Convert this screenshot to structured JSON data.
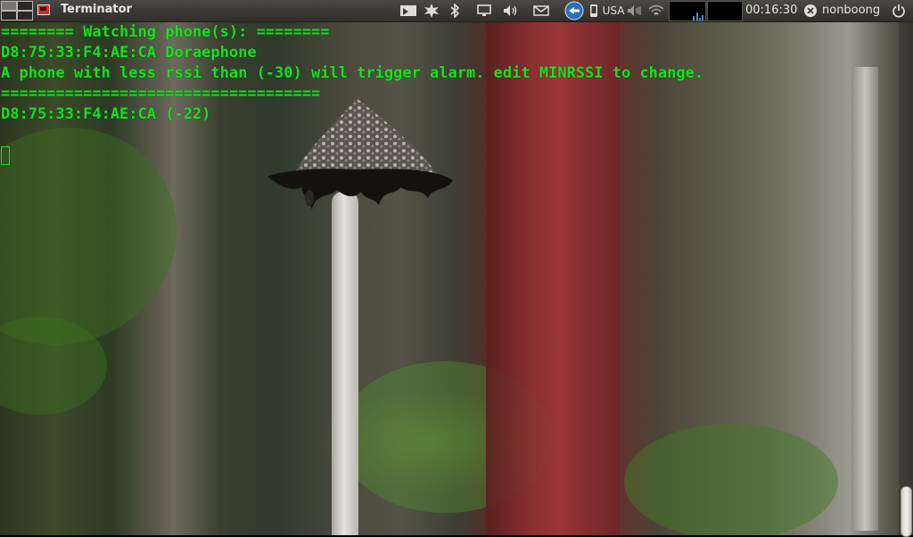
{
  "panel": {
    "app_title": "Terminator",
    "keyboard_layout": "USA",
    "clock": "00:16:30",
    "username": "nonboong",
    "icons": [
      "workspace-switcher-icon",
      "terminator-app-icon",
      "screenshot-icon",
      "network-transfer-icon",
      "bluetooth-icon",
      "display-icon",
      "volume-icon",
      "mail-icon",
      "teamviewer-icon",
      "phone-icon",
      "keyboard-layout-icon",
      "audio-level-icon",
      "wifi-icon",
      "system-monitor-icon",
      "user-icon",
      "power-icon"
    ]
  },
  "terminal": {
    "lines": [
      "======== Watching phone(s): ========",
      "D8:75:33:F4:AE:CA Doraephone",
      "A phone with less rssi than (-30) will trigger alarm. edit MINRSSI to change.",
      "===================================",
      "D8:75:33:F4:AE:CA (-22)"
    ],
    "text_color": "#14e41d"
  }
}
